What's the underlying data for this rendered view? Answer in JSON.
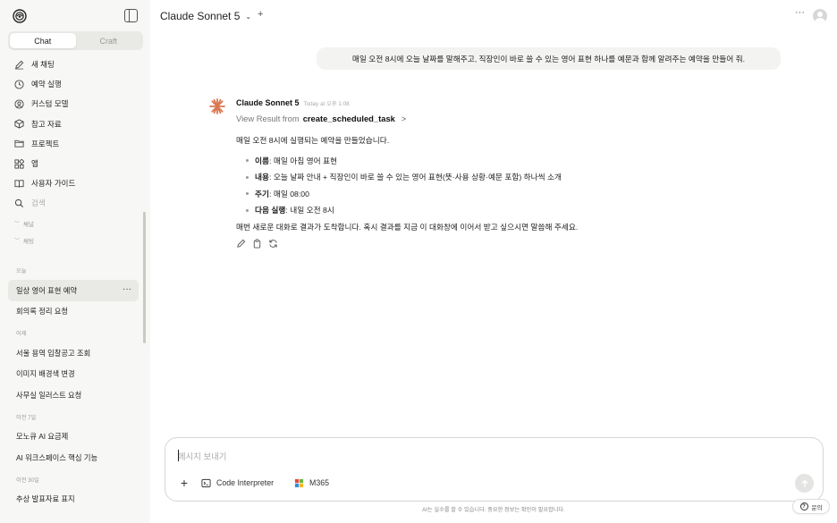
{
  "sidebar": {
    "tabs": [
      {
        "label": "Chat",
        "active": true
      },
      {
        "label": "Craft",
        "active": false
      }
    ],
    "nav": [
      {
        "label": "새 채팅",
        "icon": "edit-icon"
      },
      {
        "label": "예약 실행",
        "icon": "clock-icon"
      },
      {
        "label": "커스텀 모델",
        "icon": "custom-model-icon"
      },
      {
        "label": "참고 자료",
        "icon": "cube-icon"
      },
      {
        "label": "프로젝트",
        "icon": "folder-icon"
      },
      {
        "label": "앱",
        "icon": "apps-icon"
      },
      {
        "label": "사용자 가이드",
        "icon": "book-icon"
      },
      {
        "label": "검색",
        "icon": "search-icon"
      }
    ],
    "collapsibles": [
      "채널",
      "채팅"
    ],
    "sections": [
      {
        "title": "오늘",
        "items": [
          "일상 영어 표현 예약",
          "회의록 정리 요청"
        ]
      },
      {
        "title": "어제",
        "items": [
          "서울 용역 입찰공고 조회",
          "이미지 배경색 변경",
          "사무실 일러스트 요청"
        ]
      },
      {
        "title": "이전 7일",
        "items": [
          "모노큐 AI 요금제",
          "AI 워크스페이스 핵심 기능"
        ]
      },
      {
        "title": "이전 30일",
        "items": [
          "추상 발표자료 표지"
        ]
      }
    ],
    "active_conversation": "일상 영어 표현 예약",
    "more_glyph": "···"
  },
  "header": {
    "model": "Claude Sonnet 5",
    "dropdown_glyph": "⌄",
    "new_glyph": "+",
    "more_glyph": "···"
  },
  "chat": {
    "user_message": "매일 오전 8시에 오늘 날짜를 말해주고, 직장인이 바로 쓸 수 있는 영어 표현 하나를 예문과 함께 알려주는 예약을 만들어 줘.",
    "assistant": {
      "name": "Claude Sonnet 5",
      "time": "Today at 오후 1:08",
      "tool_prefix": "View Result from",
      "tool_name": "create_scheduled_task",
      "tool_arrow": ">",
      "intro": "매일 오전 8시에 실행되는 예약을 만들었습니다.",
      "bullets": [
        {
          "label": "이름",
          "value": ": 매일 아침 영어 표현"
        },
        {
          "label": "내용",
          "value": ": 오늘 날짜 안내 + 직장인이 바로 쓸 수 있는 영어 표현(뜻·사용 상황·예문 포함) 하나씩 소개"
        },
        {
          "label": "주기",
          "value": ": 매일 08:00"
        },
        {
          "label": "다음 실행",
          "value": ": 내일 오전 8시"
        }
      ],
      "closing": "매번 새로운 대화로 결과가 도착합니다. 혹시 결과를 지금 이 대화창에 이어서 받고 싶으시면 말씀해 주세요."
    }
  },
  "composer": {
    "placeholder": "메시지 보내기",
    "tools": [
      {
        "label": "Code Interpreter",
        "icon": "code-interpreter-icon"
      },
      {
        "label": "M365",
        "icon": "m365-icon"
      }
    ]
  },
  "footer": {
    "disclaimer": "AI는 실수를 할 수 있습니다. 중요한 정보는 확인이 필요합니다.",
    "help_label": "문의",
    "help_glyph": "?"
  },
  "colors": {
    "sidebar_bg": "#f7f7f5",
    "accent": "#d9774f",
    "m365_red": "#e8493c",
    "m365_green": "#6bb740",
    "m365_blue": "#2f8fe0",
    "m365_yellow": "#f5b81f"
  }
}
